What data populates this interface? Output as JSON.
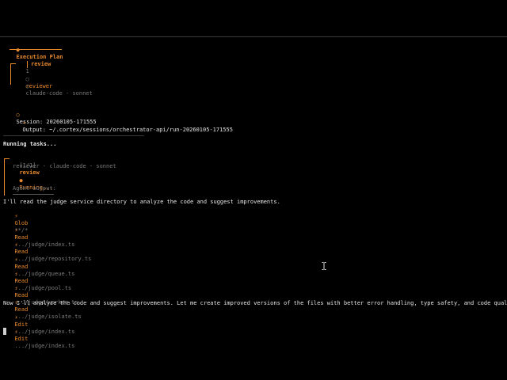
{
  "colors": {
    "accent": "#e8892c",
    "dim": "#7a7a7a",
    "text": "#e6e6e6",
    "bg": "#000000"
  },
  "plan": {
    "bullet": "●",
    "title": "Execution Plan",
    "step_num": "1",
    "step_name": "review",
    "agent_circle": "○",
    "agent": "reviewer",
    "model_circle": "○",
    "model": "claude-code · sonnet"
  },
  "session": {
    "circle": "○",
    "label": "Session: 20260105-171555",
    "output_arrow": "→",
    "output": "Output: ~/.cortex/sessions/orchestrator-api/run-20260105-171555"
  },
  "running": {
    "header": "Running tasks...",
    "task_counter": "[1/1]",
    "task_name": "review",
    "task_meta": "reviewer · claude-code · sonnet",
    "status_dot": "●",
    "status": "Running...",
    "agent_output_label": "Agent output:"
  },
  "log": {
    "intro": "I'll read the judge service directory to analyze the code and suggest improvements.",
    "tools": [
      {
        "icon": "⚡",
        "name": "Glob",
        "arg": "**/*"
      },
      {
        "icon": "⚡",
        "name": "Read",
        "arg": ".../judge/index.ts"
      },
      {
        "icon": "⚡",
        "name": "Read",
        "arg": ".../judge/repository.ts"
      },
      {
        "icon": "⚡",
        "name": "Read",
        "arg": ".../judge/queue.ts"
      },
      {
        "icon": "⚡",
        "name": "Read",
        "arg": ".../judge/pool.ts"
      },
      {
        "icon": "⚡",
        "name": "Read",
        "arg": ".../judge/worker.ts"
      },
      {
        "icon": "⚡",
        "name": "Read",
        "arg": ".../judge/isolate.ts"
      }
    ],
    "summary": "Now I'll analyze the code and suggest improvements. Let me create improved versions of the files with better error handling, type safety, and code quality.",
    "edits": [
      {
        "icon": "⚡",
        "name": "Edit",
        "arg": ".../judge/index.ts"
      },
      {
        "icon": "⚡",
        "name": "Edit",
        "arg": ".../judge/index.ts"
      }
    ]
  }
}
